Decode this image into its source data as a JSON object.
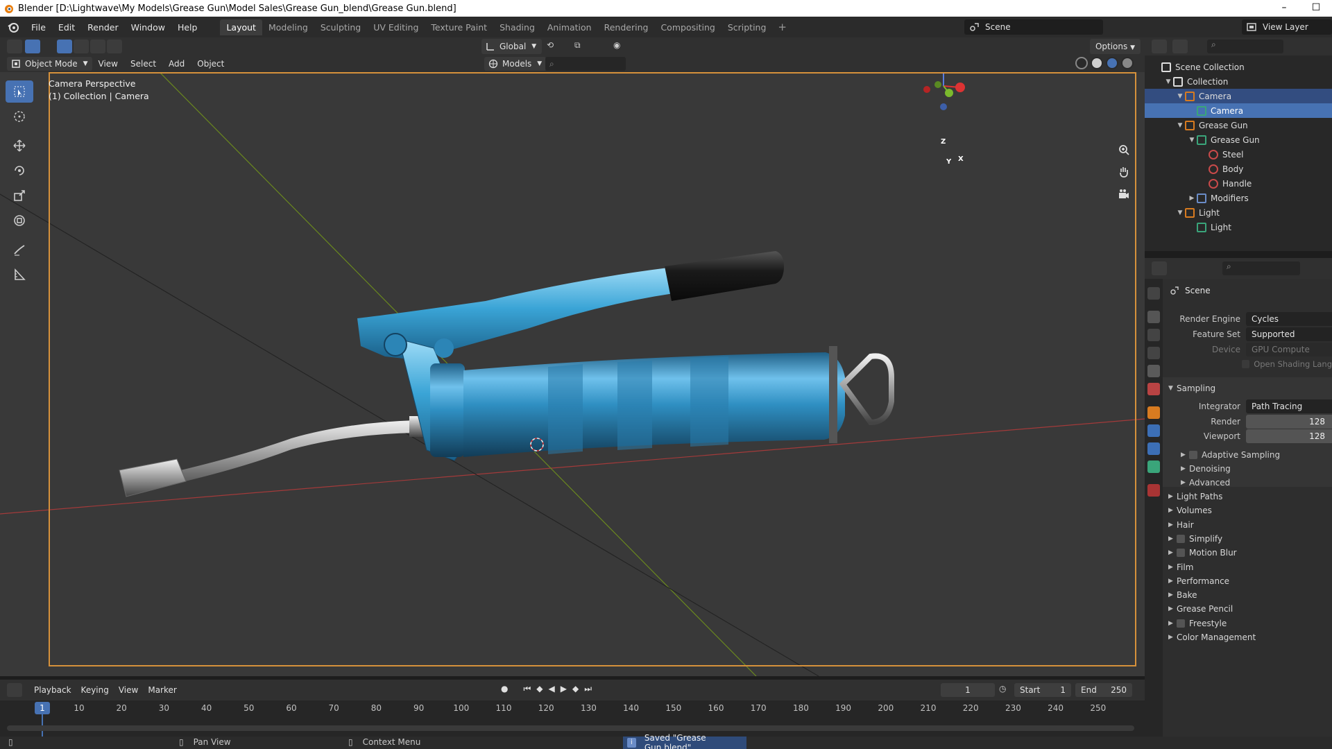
{
  "window": {
    "title": "Blender [D:\\Lightwave\\My Models\\Grease Gun\\Model Sales\\Grease Gun_blend\\Grease Gun.blend]",
    "minimize": "–",
    "maximize": "☐"
  },
  "menubar": {
    "items": [
      "File",
      "Edit",
      "Render",
      "Window",
      "Help"
    ],
    "workspaces": [
      "Layout",
      "Modeling",
      "Sculpting",
      "UV Editing",
      "Texture Paint",
      "Shading",
      "Animation",
      "Rendering",
      "Compositing",
      "Scripting"
    ],
    "active_workspace": "Layout",
    "add_workspace": "+",
    "scene": "Scene",
    "view_layer": "View Layer"
  },
  "viewport_toolbar": {
    "orientation": "Global",
    "options": "Options"
  },
  "viewport_header": {
    "mode": "Object Mode",
    "menus": [
      "View",
      "Select",
      "Add",
      "Object"
    ],
    "collection_filter": "Models"
  },
  "viewport": {
    "line1": "Camera Perspective",
    "line2": "(1) Collection | Camera",
    "gizmo": {
      "x": "X",
      "y": "Y",
      "z": "Z"
    }
  },
  "outliner": {
    "rows": [
      {
        "label": "Scene Collection",
        "indent": 0,
        "type": "scene-collection"
      },
      {
        "label": "Collection",
        "indent": 1,
        "type": "collection"
      },
      {
        "label": "Camera",
        "indent": 2,
        "type": "camera-object",
        "selected": "light"
      },
      {
        "label": "Camera",
        "indent": 3,
        "type": "camera-data",
        "selected": "active"
      },
      {
        "label": "Grease Gun",
        "indent": 2,
        "type": "mesh-object"
      },
      {
        "label": "Grease Gun",
        "indent": 3,
        "type": "mesh-data"
      },
      {
        "label": "Steel",
        "indent": 4,
        "type": "material"
      },
      {
        "label": "Body",
        "indent": 4,
        "type": "material"
      },
      {
        "label": "Handle",
        "indent": 4,
        "type": "material"
      },
      {
        "label": "Modifiers",
        "indent": 3,
        "type": "modifier"
      },
      {
        "label": "Light",
        "indent": 2,
        "type": "light-object"
      },
      {
        "label": "Light",
        "indent": 3,
        "type": "light-data"
      }
    ]
  },
  "properties": {
    "context": "Scene",
    "render_engine_label": "Render Engine",
    "render_engine": "Cycles",
    "feature_set_label": "Feature Set",
    "feature_set": "Supported",
    "device_label": "Device",
    "device": "GPU Compute",
    "open_shading": "Open Shading Lang",
    "sampling": "Sampling",
    "integrator_label": "Integrator",
    "integrator": "Path Tracing",
    "render_label": "Render",
    "render_samples": "128",
    "viewport_label": "Viewport",
    "viewport_samples": "128",
    "sampling_subs": [
      "Adaptive Sampling",
      "Denoising",
      "Advanced"
    ],
    "sections": [
      {
        "label": "Light Paths",
        "checkbox": false
      },
      {
        "label": "Volumes",
        "checkbox": false
      },
      {
        "label": "Hair",
        "checkbox": false
      },
      {
        "label": "Simplify",
        "checkbox": true
      },
      {
        "label": "Motion Blur",
        "checkbox": true
      },
      {
        "label": "Film",
        "checkbox": false
      },
      {
        "label": "Performance",
        "checkbox": false
      },
      {
        "label": "Bake",
        "checkbox": false
      },
      {
        "label": "Grease Pencil",
        "checkbox": false
      },
      {
        "label": "Freestyle",
        "checkbox": true
      },
      {
        "label": "Color Management",
        "checkbox": false
      }
    ]
  },
  "timeline": {
    "menus": [
      "Playback",
      "Keying",
      "View",
      "Marker"
    ],
    "current_frame": "1",
    "start_label": "Start",
    "start": "1",
    "end_label": "End",
    "end": "250",
    "ruler": [
      "10",
      "20",
      "30",
      "40",
      "50",
      "60",
      "70",
      "80",
      "90",
      "100",
      "110",
      "120",
      "130",
      "140",
      "150",
      "160",
      "170",
      "180",
      "190",
      "200",
      "210",
      "220",
      "230",
      "240",
      "250"
    ]
  },
  "statusbar": {
    "pan": "Pan View",
    "context": "Context Menu",
    "saved": "Saved \"Grease Gun.blend\""
  },
  "colors": {
    "accent": "#4772b3",
    "camera_frame": "#d6913b",
    "gun_blue": "#2f8fc2"
  }
}
